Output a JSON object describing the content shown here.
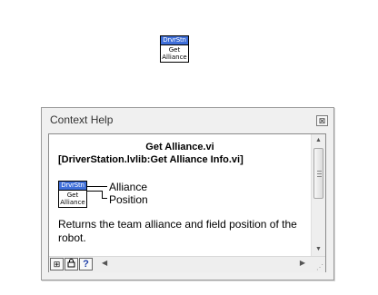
{
  "block_icon": {
    "banner": "DrvrStn",
    "line1": "Get",
    "line2": "Alliance"
  },
  "context_help": {
    "title": "Context Help",
    "close_glyph": "⊠",
    "vi_name": "Get Alliance.vi",
    "vi_path": "[DriverStation.lvlib:Get Alliance Info.vi]",
    "terminals": [
      "Alliance",
      "Position"
    ],
    "description": "Returns the team alliance and field position of the robot.",
    "bottom_buttons": [
      {
        "icon": "show-optional-terminals-icon",
        "glyph": "⊞"
      },
      {
        "icon": "lock-icon",
        "glyph": "🔒"
      },
      {
        "icon": "help-icon",
        "glyph": "?"
      }
    ]
  },
  "colors": {
    "icon_banner": "#3f6fd9",
    "help_button": "#1e3fa8"
  }
}
